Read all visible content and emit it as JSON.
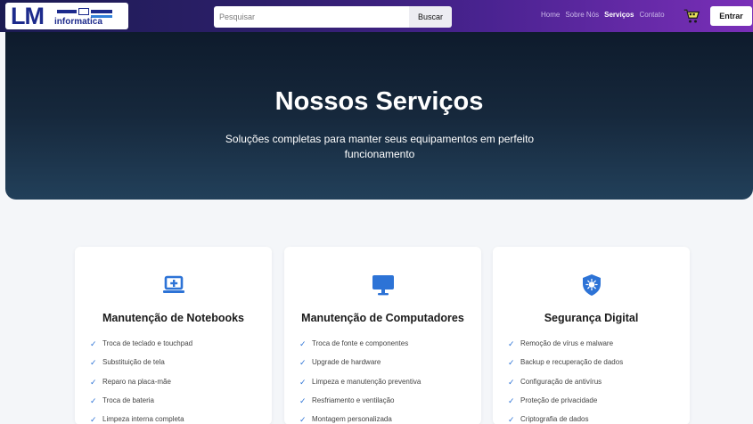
{
  "header": {
    "logo": {
      "letters": "LM",
      "subtitle": "informatica"
    },
    "search": {
      "placeholder": "Pesquisar",
      "button_label": "Buscar"
    },
    "nav": [
      {
        "label": "Home",
        "active": false
      },
      {
        "label": "Sobre Nós",
        "active": false
      },
      {
        "label": "Serviços",
        "active": true
      },
      {
        "label": "Contato",
        "active": false
      }
    ],
    "cart_icon": "shopping-cart-icon",
    "login_label": "Entrar"
  },
  "hero": {
    "title": "Nossos Serviços",
    "subtitle": "Soluções completas para manter seus equipamentos em perfeito funcionamento"
  },
  "colors": {
    "accent": "#2d73d6",
    "header_start": "#1b1b52",
    "header_end": "#7a2fb8",
    "hero": "#16283c"
  },
  "cards": [
    {
      "icon": "laptop-plus-icon",
      "title": "Manutenção de Notebooks",
      "items": [
        "Troca de teclado e touchpad",
        "Substituição de tela",
        "Reparo na placa-mãe",
        "Troca de bateria",
        "Limpeza interna completa"
      ]
    },
    {
      "icon": "monitor-icon",
      "title": "Manutenção de Computadores",
      "items": [
        "Troca de fonte e componentes",
        "Upgrade de hardware",
        "Limpeza e manutenção preventiva",
        "Resfriamento e ventilação",
        "Montagem personalizada"
      ]
    },
    {
      "icon": "shield-virus-icon",
      "title": "Segurança Digital",
      "items": [
        "Remoção de vírus e malware",
        "Backup e recuperação de dados",
        "Configuração de antivírus",
        "Proteção de privacidade",
        "Criptografia de dados"
      ]
    }
  ]
}
